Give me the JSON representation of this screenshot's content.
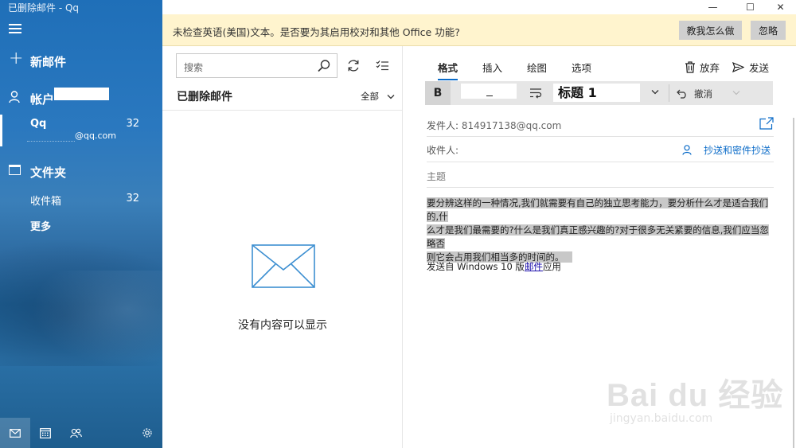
{
  "window": {
    "title": "已删除邮件 - Qq",
    "controls": [
      "—",
      "☐",
      "✕"
    ]
  },
  "sidebar": {
    "new_mail": "新邮件",
    "accounts_label": "帐户",
    "account": {
      "name": "Qq",
      "count": "32",
      "email": "@qq.com"
    },
    "folders_label": "文件夹",
    "inbox": {
      "label": "收件箱",
      "count": "32"
    },
    "more": "更多",
    "bottom_icons": [
      "mail-icon",
      "calendar-icon",
      "people-icon",
      "settings-icon"
    ]
  },
  "infobar": {
    "message": "未检查英语(美国)文本。是否要为其启用校对和其他 Office 功能?",
    "teach_button": "教我怎么做",
    "ignore_button": "忽略"
  },
  "list": {
    "search_placeholder": "搜索",
    "title": "已删除邮件",
    "filter": "全部",
    "empty_message": "没有内容可以显示"
  },
  "compose": {
    "tabs": [
      "格式",
      "插入",
      "绘图",
      "选项"
    ],
    "discard": "放弃",
    "send": "发送",
    "toolbar": {
      "bold": "B",
      "style": "标题 1",
      "undo": "撤消"
    },
    "from_label": "发件人:",
    "from_value": "814917138@qq.com",
    "to_label": "收件人:",
    "cc_bcc": "抄送和密件抄送",
    "subject_placeholder": "主题",
    "body_line1": "要分辨这样的一种情况,我们就需要有自己的独立思考能力，要分析什么才是适合我们的,什",
    "body_line2": "么才是我们最需要的?什么是我们真正感兴趣的?对于很多无关紧要的信息,我们应当忽略否",
    "body_line3": "则它会占用我们相当多的时间的。",
    "signature_prefix": "发送自 Windows 10 版",
    "signature_link": "邮件",
    "signature_suffix": "应用"
  },
  "watermark": {
    "brand": "Bai du 经验",
    "url": "jingyan.baidu.com"
  },
  "colors": {
    "accent": "#0a6bc8",
    "sidebar": "#2a74b8",
    "infobar": "#fff4ce"
  }
}
